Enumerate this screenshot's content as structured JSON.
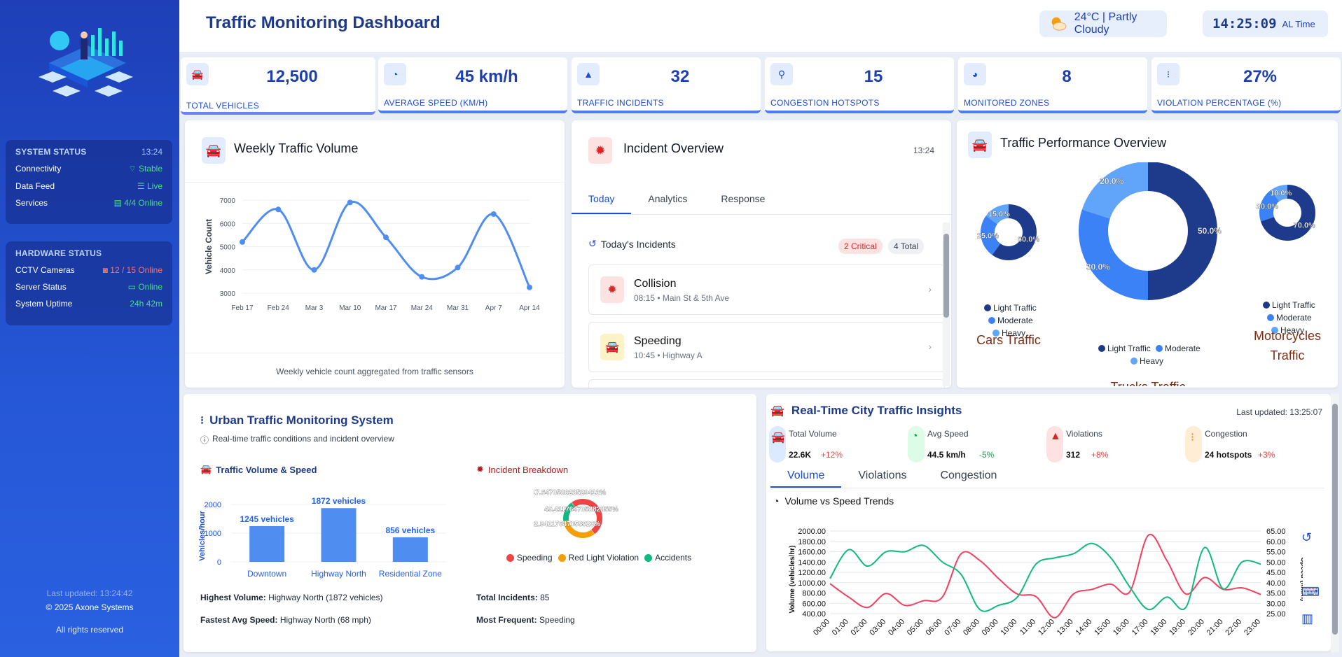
{
  "header": {
    "title": "Traffic Monitoring Dashboard",
    "weather": "24°C | Partly Cloudy",
    "time": "14:25:09",
    "time_label": "AL Time"
  },
  "sidebar": {
    "system": {
      "title": "SYSTEM STATUS",
      "time": "13:24",
      "rows": [
        {
          "label": "Connectivity",
          "value": "Stable"
        },
        {
          "label": "Data Feed",
          "value": "Live"
        },
        {
          "label": "Services",
          "value": "4/4 Online"
        }
      ]
    },
    "hardware": {
      "title": "HARDWARE STATUS",
      "rows": [
        {
          "label": "CCTV Cameras",
          "value": "12 / 15 Online"
        },
        {
          "label": "Server Status",
          "value": "Online"
        },
        {
          "label": "System Uptime",
          "value": "24h 42m"
        }
      ]
    },
    "footer": {
      "updated": "Last updated: 13:24:42",
      "copyright": "© 2025 Axone Systems",
      "rights": "All rights reserved"
    }
  },
  "kpis": [
    {
      "value": "12,500",
      "label": "TOTAL VEHICLES",
      "icon": "car-icon"
    },
    {
      "value": "45 km/h",
      "label": "AVERAGE SPEED (KM/H)",
      "icon": "speedometer-icon"
    },
    {
      "value": "32",
      "label": "TRAFFIC INCIDENTS",
      "icon": "warning-icon"
    },
    {
      "value": "15",
      "label": "CONGESTION HOTSPOTS",
      "icon": "map-pin-icon"
    },
    {
      "value": "8",
      "label": "MONITORED ZONES",
      "icon": "pie-icon"
    },
    {
      "value": "27%",
      "label": "VIOLATION PERCENTAGE (%)",
      "icon": "traffic-light-icon"
    }
  ],
  "weekly": {
    "title": "Weekly Traffic Volume",
    "caption": "Weekly vehicle count aggregated from traffic sensors"
  },
  "incident_overview": {
    "title": "Incident Overview",
    "time": "13:24",
    "tabs": [
      "Today",
      "Analytics",
      "Response"
    ],
    "section_title": "Today's Incidents",
    "critical_badge": "2 Critical",
    "total_badge": "4 Total",
    "items": [
      {
        "name": "Collision",
        "detail": "08:15 • Main St & 5th Ave"
      },
      {
        "name": "Speeding",
        "detail": "10:45 • Highway A"
      }
    ]
  },
  "performance": {
    "title": "Traffic Performance Overview",
    "legend": [
      "Light Traffic",
      "Moderate",
      "Heavy"
    ],
    "donuts": [
      {
        "label": "Cars Traffic",
        "values": [
          60,
          25,
          15
        ],
        "labels": [
          "60.0%",
          "25.0%",
          "15.0%"
        ]
      },
      {
        "label": "Trucks Traffic",
        "values": [
          50,
          30,
          20
        ],
        "labels": [
          "50.0%",
          "30.0%",
          "20.0%"
        ]
      },
      {
        "label": "Motorcycles Traffic",
        "values": [
          70,
          20,
          10
        ],
        "labels": [
          "70.0%",
          "20.0%",
          "10.0%"
        ]
      }
    ],
    "colors": [
      "#1e3a8a",
      "#3b82f6",
      "#60a5fa"
    ]
  },
  "urban": {
    "title": "Urban Traffic Monitoring System",
    "subtitle": "Real-time traffic conditions and incident overview",
    "volume_title": "Traffic Volume & Speed",
    "incident_title": "Incident Breakdown",
    "highest_label": "Highest Volume:",
    "highest_value": "Highway North (1872 vehicles)",
    "fastest_label": "Fastest Avg Speed:",
    "fastest_value": "Highway North (68 mph)",
    "total_label": "Total Incidents:",
    "total_value": "85",
    "frequent_label": "Most Frequent:",
    "frequent_value": "Speeding",
    "donut_labels": [
      "17.647058823529413%",
      "49.411764705882355%",
      "32.94117647058823%"
    ]
  },
  "insights": {
    "title": "Real-Time City Traffic Insights",
    "updated": "Last updated: 13:25:07",
    "metrics": [
      {
        "label": "Total Volume",
        "value": "22.6K",
        "delta": "+12%",
        "color": "#3b82f6"
      },
      {
        "label": "Avg Speed",
        "value": "44.5 km/h",
        "delta": "-5%",
        "color": "#16a34a"
      },
      {
        "label": "Violations",
        "value": "312",
        "delta": "+8%",
        "color": "#dc2626"
      },
      {
        "label": "Congestion",
        "value": "24 hotspots",
        "delta": "+3%",
        "color": "#f97316"
      }
    ],
    "tabs": [
      "Volume",
      "Violations",
      "Congestion"
    ],
    "chart_title": "Volume vs Speed Trends"
  },
  "chart_data": [
    {
      "type": "line",
      "title": "Weekly Traffic Volume",
      "ylabel": "Vehicle Count",
      "categories": [
        "Feb 17",
        "Feb 24",
        "Mar 3",
        "Mar 10",
        "Mar 17",
        "Mar 24",
        "Mar 31",
        "Apr 7",
        "Apr 14"
      ],
      "values": [
        5200,
        6600,
        4000,
        6900,
        5400,
        3700,
        4100,
        6400,
        3250
      ],
      "ylim": [
        3000,
        7000
      ],
      "yticks": [
        3000,
        4000,
        5000,
        6000,
        7000
      ],
      "color": "#4f8ef0"
    },
    {
      "type": "bar",
      "title": "Traffic Volume & Speed",
      "ylabel": "Vehicles/hour",
      "categories": [
        "Downtown",
        "Highway North",
        "Residential Zone"
      ],
      "values": [
        1245,
        1872,
        856
      ],
      "data_labels": [
        "1245 vehicles",
        "1872 vehicles",
        "856 vehicles"
      ],
      "ylim": [
        0,
        2000
      ],
      "yticks": [
        0,
        1000,
        2000
      ]
    },
    {
      "type": "pie",
      "title": "Incident Breakdown",
      "categories": [
        "Speeding",
        "Red Light Violation",
        "Accidents"
      ],
      "values": [
        49.411764705882355,
        32.94117647058823,
        17.647058823529413
      ],
      "colors": [
        "#ef4444",
        "#f59e0b",
        "#10b981"
      ]
    },
    {
      "type": "line",
      "title": "Volume vs Speed Trends",
      "ylabel": "Volume (vehicles/hr)",
      "ylabel_right": "Speed (km/h)",
      "categories": [
        "00:00",
        "01:00",
        "02:00",
        "03:00",
        "04:00",
        "05:00",
        "06:00",
        "07:00",
        "08:00",
        "09:00",
        "10:00",
        "11:00",
        "12:00",
        "13:00",
        "14:00",
        "15:00",
        "16:00",
        "17:00",
        "18:00",
        "19:00",
        "20:00",
        "21:00",
        "22:00",
        "23:00"
      ],
      "series": [
        {
          "name": "Volume",
          "axis": "left",
          "color": "#f43f5e",
          "values": [
            980,
            720,
            520,
            790,
            560,
            650,
            720,
            1560,
            1430,
            1080,
            780,
            730,
            320,
            780,
            870,
            970,
            820,
            1920,
            1420,
            780,
            1100,
            870,
            900,
            770
          ]
        },
        {
          "name": "Speed",
          "axis": "right",
          "color": "#10b981",
          "values": [
            42,
            56,
            48,
            55,
            55,
            58,
            50,
            44,
            27,
            29,
            33,
            49,
            52,
            54,
            59,
            52,
            38,
            27,
            33,
            28,
            57,
            37,
            50,
            49
          ]
        }
      ],
      "ylim": [
        400,
        2000
      ],
      "ylim_right": [
        25,
        65
      ],
      "yticks": [
        "400.00",
        "600.00",
        "800.00",
        "1000.00",
        "1200.00",
        "1400.00",
        "1600.00",
        "1800.00",
        "2000.00"
      ],
      "yticks_right": [
        "25.00",
        "30.00",
        "35.00",
        "40.00",
        "45.00",
        "50.00",
        "55.00",
        "60.00",
        "65.00"
      ]
    }
  ]
}
